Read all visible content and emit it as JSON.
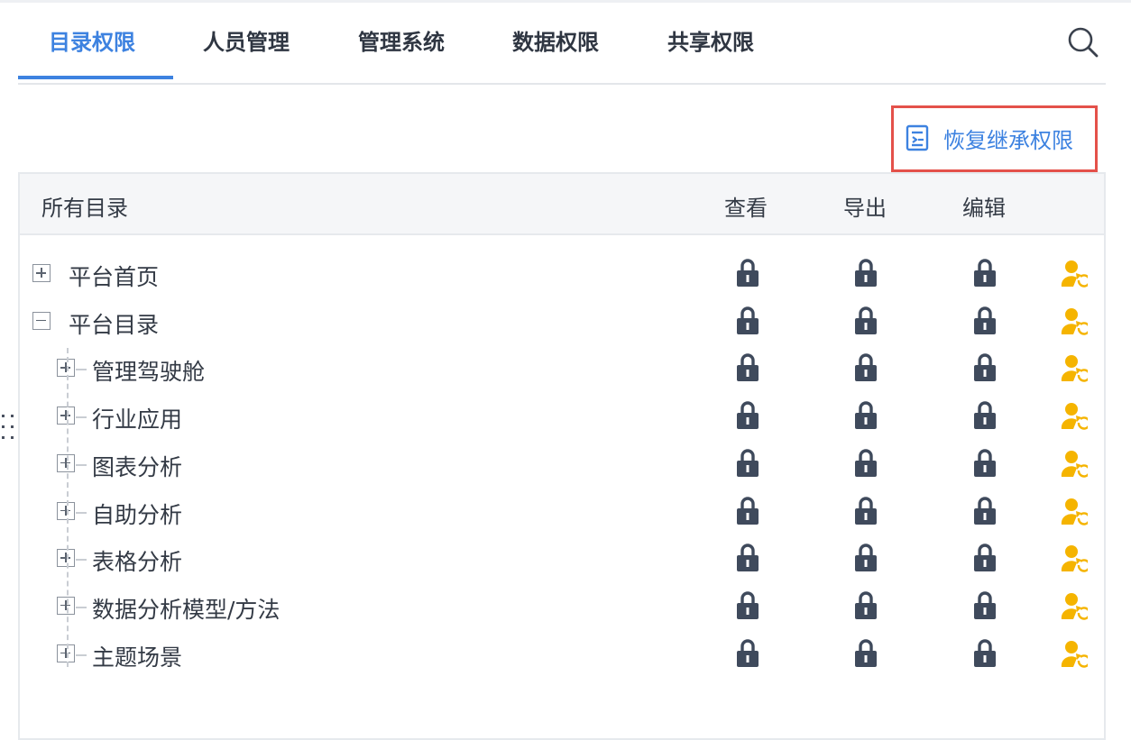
{
  "tabs": [
    {
      "label": "目录权限",
      "active": true
    },
    {
      "label": "人员管理",
      "active": false
    },
    {
      "label": "管理系统",
      "active": false
    },
    {
      "label": "数据权限",
      "active": false
    },
    {
      "label": "共享权限",
      "active": false
    }
  ],
  "toolbar": {
    "restore_label": "恢复继承权限"
  },
  "table": {
    "headers": {
      "name": "所有目录",
      "view": "查看",
      "export": "导出",
      "edit": "编辑"
    },
    "rows": [
      {
        "label": "平台首页",
        "expanded": false,
        "level": 0
      },
      {
        "label": "平台目录",
        "expanded": true,
        "level": 0
      },
      {
        "label": "管理驾驶舱",
        "expanded": false,
        "level": 1
      },
      {
        "label": "行业应用",
        "expanded": false,
        "level": 1
      },
      {
        "label": "图表分析",
        "expanded": false,
        "level": 1
      },
      {
        "label": "自助分析",
        "expanded": false,
        "level": 1
      },
      {
        "label": "表格分析",
        "expanded": false,
        "level": 1
      },
      {
        "label": "数据分析模型/方法",
        "expanded": false,
        "level": 1
      },
      {
        "label": "主题场景",
        "expanded": false,
        "level": 1
      }
    ]
  },
  "icons": {
    "search": "search-icon",
    "restore": "restore-inherit-icon",
    "lock": "lock-icon",
    "inherit": "user-inherit-icon",
    "drag": "drag-handle-icon"
  },
  "colors": {
    "accent": "#3d82e0",
    "highlight_border": "#e4514a",
    "lock": "#3f4a5c",
    "inherit": "#f5b400"
  }
}
